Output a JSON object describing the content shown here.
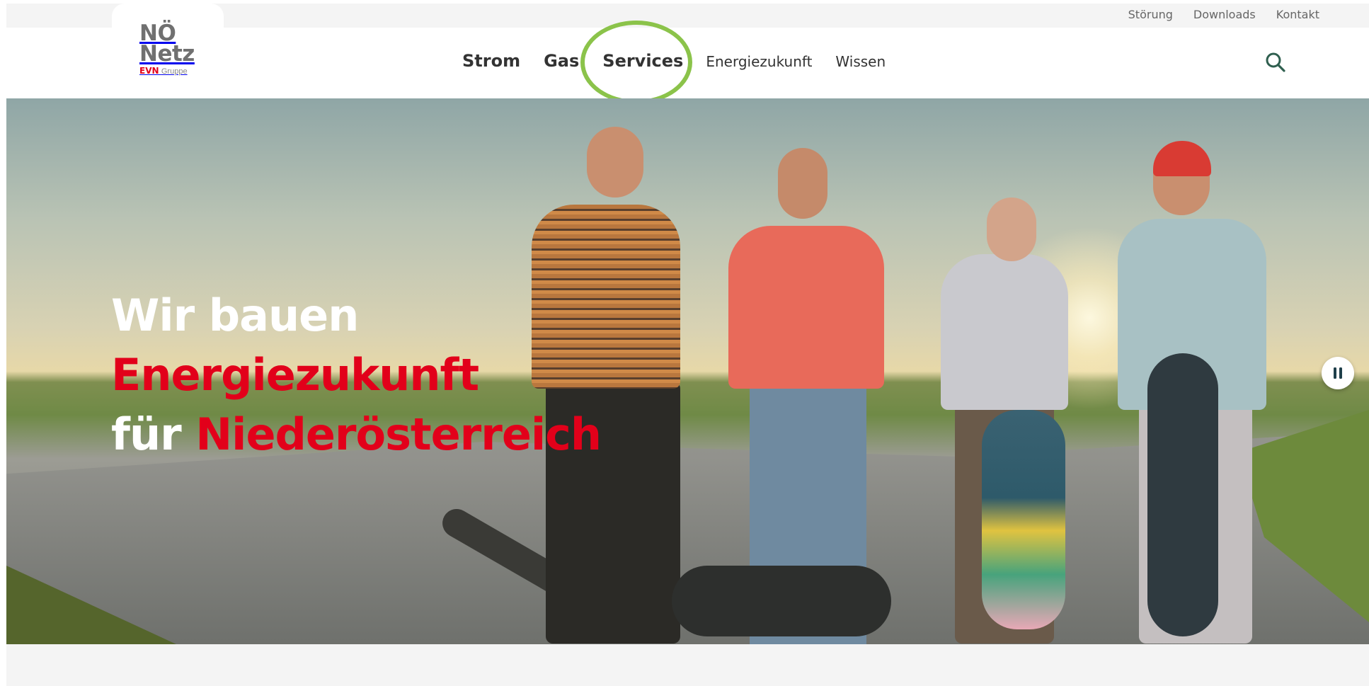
{
  "utility_nav": {
    "links": [
      {
        "label": "Störung"
      },
      {
        "label": "Downloads"
      },
      {
        "label": "Kontakt"
      }
    ]
  },
  "logo": {
    "line1": "NÖ",
    "line2": "Netz",
    "evn": "EVN",
    "gruppe": "Gruppe"
  },
  "main_nav": {
    "items": [
      {
        "label": "Strom"
      },
      {
        "label": "Gas"
      },
      {
        "label": "Services"
      },
      {
        "label": "Energiezukunft"
      },
      {
        "label": "Wissen"
      }
    ],
    "highlighted_item": "Services"
  },
  "search": {
    "icon": "search-icon"
  },
  "hero": {
    "line1": "Wir bauen",
    "line2": "Energiezukunft",
    "line3_prefix": "für",
    "line3_highlight": "Niederösterreich",
    "pause_icon": "pause-icon"
  },
  "colors": {
    "brand_red": "#e2001a",
    "logo_gray": "#707070",
    "highlight_ring": "#8bc34a",
    "search_icon": "#2f5f4f"
  }
}
